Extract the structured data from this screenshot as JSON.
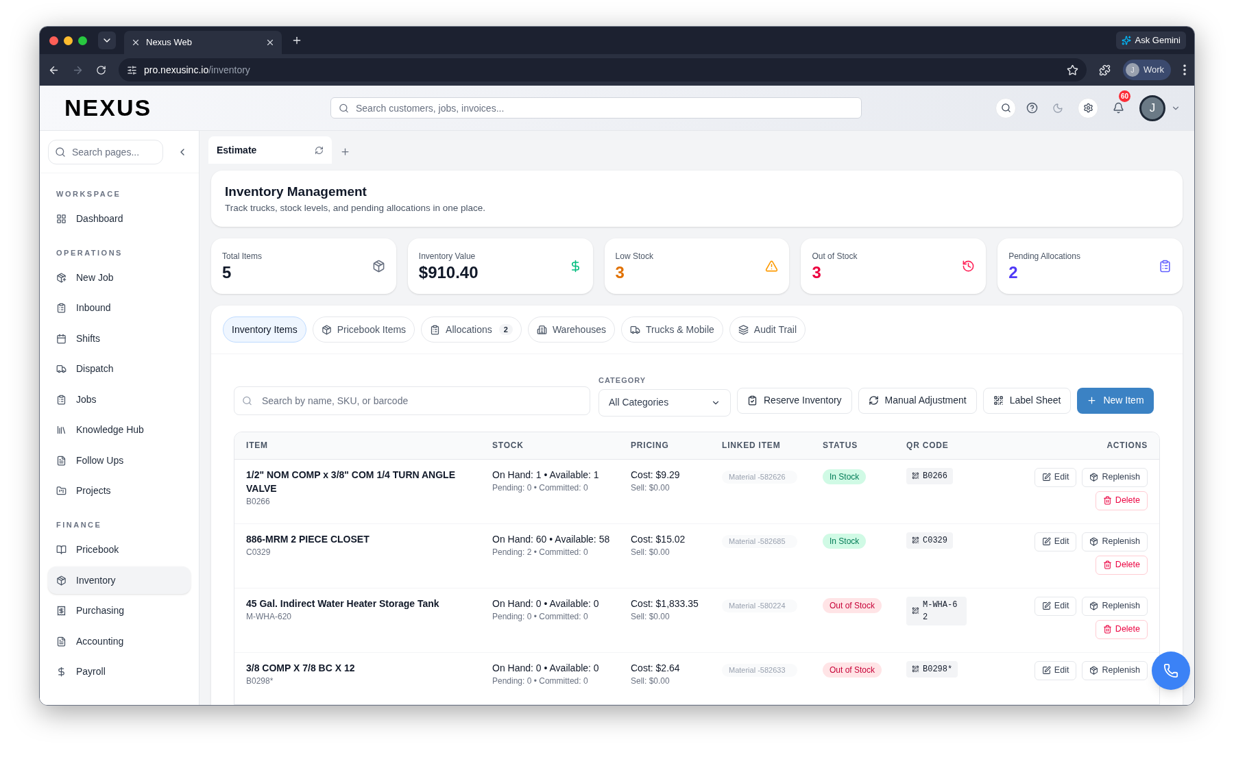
{
  "browser": {
    "tab_title": "Nexus Web",
    "url_host": "pro.nexusinc.io",
    "url_path": "/inventory",
    "ask_button": "Ask Gemini",
    "profile_initial": "J",
    "profile_label": "Work"
  },
  "header": {
    "logo": "NEXUS",
    "search_placeholder": "Search customers, jobs, invoices...",
    "notification_count": "60",
    "avatar_initial": "J"
  },
  "sidebar": {
    "search_placeholder": "Search pages...",
    "sections": [
      {
        "title": "WORKSPACE",
        "items": [
          {
            "label": "Dashboard",
            "selected": false
          }
        ]
      },
      {
        "title": "OPERATIONS",
        "items": [
          {
            "label": "New Job",
            "selected": false
          },
          {
            "label": "Inbound",
            "selected": false
          },
          {
            "label": "Shifts",
            "selected": false
          },
          {
            "label": "Dispatch",
            "selected": false
          },
          {
            "label": "Jobs",
            "selected": false
          },
          {
            "label": "Knowledge Hub",
            "selected": false
          },
          {
            "label": "Follow Ups",
            "selected": false
          },
          {
            "label": "Projects",
            "selected": false
          }
        ]
      },
      {
        "title": "FINANCE",
        "items": [
          {
            "label": "Pricebook",
            "selected": false
          },
          {
            "label": "Inventory",
            "selected": true
          },
          {
            "label": "Purchasing",
            "selected": false
          },
          {
            "label": "Accounting",
            "selected": false
          },
          {
            "label": "Payroll",
            "selected": false
          }
        ]
      }
    ]
  },
  "page_tabs": [
    {
      "label": "Estimate",
      "selected": true
    }
  ],
  "page": {
    "title": "Inventory Management",
    "subtitle": "Track trucks, stock levels, and pending allocations in one place."
  },
  "stats": [
    {
      "label": "Total Items",
      "value": "5",
      "kind": "neutral"
    },
    {
      "label": "Inventory Value",
      "value": "$910.40",
      "kind": "money"
    },
    {
      "label": "Low Stock",
      "value": "3",
      "kind": "warning"
    },
    {
      "label": "Out of Stock",
      "value": "3",
      "kind": "danger"
    },
    {
      "label": "Pending Allocations",
      "value": "2",
      "kind": "pending"
    }
  ],
  "tabs": [
    {
      "label": "Inventory Items",
      "selected": true
    },
    {
      "label": "Pricebook Items",
      "selected": false
    },
    {
      "label": "Allocations",
      "count": "2",
      "selected": false
    },
    {
      "label": "Warehouses",
      "selected": false
    },
    {
      "label": "Trucks & Mobile",
      "selected": false
    },
    {
      "label": "Audit Trail",
      "selected": false
    }
  ],
  "toolbar": {
    "search_placeholder": "Search by name, SKU, or barcode",
    "category_label": "CATEGORY",
    "category_value": "All Categories",
    "buttons": [
      {
        "label": "Reserve Inventory",
        "kind": "reserve"
      },
      {
        "label": "Manual Adjustment",
        "kind": "adjust"
      },
      {
        "label": "Label Sheet",
        "kind": "labels"
      },
      {
        "label": "New Item",
        "kind": "primary"
      }
    ]
  },
  "table": {
    "columns": [
      "ITEM",
      "STOCK",
      "PRICING",
      "LINKED ITEM",
      "STATUS",
      "QR CODE",
      "ACTIONS"
    ],
    "rows": [
      {
        "name": "1/2\" NOM COMP x 3/8\" COM 1/4 TURN ANGLE VALVE",
        "sku": "B0266",
        "stock": "On Hand: 1 • Available: 1",
        "stock_detail": "Pending: 0 • Committed: 0",
        "cost": "Cost: $9.29",
        "sell": "Sell: $0.00",
        "linked": "Material -582626",
        "status": {
          "label": "In Stock",
          "kind": "in"
        },
        "qr": "B0266",
        "actions": [
          "Edit",
          "Replenish",
          "Delete"
        ]
      },
      {
        "name": "886-MRM 2 PIECE CLOSET",
        "sku": "C0329",
        "stock": "On Hand: 60 • Available: 58",
        "stock_detail": "Pending: 2 • Committed: 0",
        "cost": "Cost: $15.02",
        "sell": "Sell: $0.00",
        "linked": "Material -582685",
        "status": {
          "label": "In Stock",
          "kind": "in"
        },
        "qr": "C0329",
        "actions": [
          "Edit",
          "Replenish",
          "Delete"
        ]
      },
      {
        "name": "45 Gal. Indirect Water Heater Storage Tank",
        "sku": "M-WHA-620",
        "stock": "On Hand: 0 • Available: 0",
        "stock_detail": "Pending: 0 • Committed: 0",
        "cost": "Cost: $1,833.35",
        "sell": "Sell: $0.00",
        "linked": "Material -580224",
        "status": {
          "label": "Out of Stock",
          "kind": "out"
        },
        "qr": "M-WHA-62",
        "actions": [
          "Edit",
          "Replenish",
          "Delete"
        ]
      },
      {
        "name": "3/8 COMP X 7/8 BC X 12",
        "sku": "B0298*",
        "stock": "On Hand: 0 • Available: 0",
        "stock_detail": "Pending: 0 • Committed: 0",
        "cost": "Cost: $2.64",
        "sell": "Sell: $0.00",
        "linked": "Material -582633",
        "status": {
          "label": "Out of Stock",
          "kind": "out"
        },
        "qr": "B0298*",
        "actions": [
          "Edit",
          "Replenish"
        ]
      }
    ]
  }
}
